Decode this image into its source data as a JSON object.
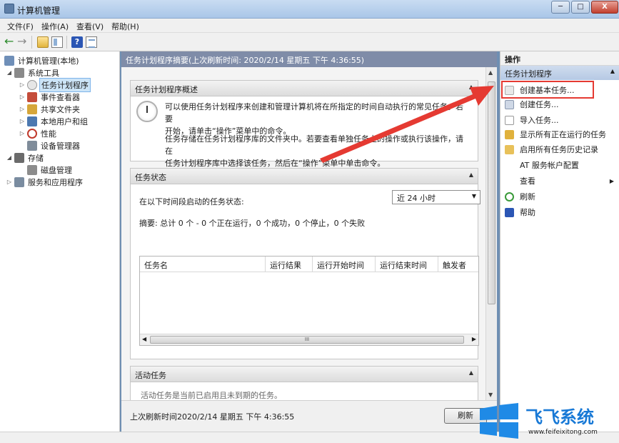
{
  "window": {
    "title": "计算机管理"
  },
  "window_buttons": {
    "minimize": "─",
    "maximize": "□",
    "close": "X"
  },
  "menu": [
    "文件(F)",
    "操作(A)",
    "查看(V)",
    "帮助(H)"
  ],
  "toolbar": {
    "back_icon": "←",
    "forward_icon": "→",
    "help_label": "?"
  },
  "tree": {
    "items": [
      {
        "label": "计算机管理(本地)",
        "icon": "computer-icon",
        "color": "#6f8fb8"
      },
      {
        "label": "系统工具",
        "icon": "tools-icon",
        "color": "#8a8a8a"
      },
      {
        "label": "任务计划程序",
        "icon": "clock-icon",
        "color": "#d9d9d9"
      },
      {
        "label": "事件查看器",
        "icon": "event-viewer-icon",
        "color": "#c44c3a"
      },
      {
        "label": "共享文件夹",
        "icon": "shared-folder-icon",
        "color": "#d6a63a"
      },
      {
        "label": "本地用户和组",
        "icon": "users-icon",
        "color": "#4c78b0"
      },
      {
        "label": "性能",
        "icon": "performance-icon",
        "color": "#c0392b"
      },
      {
        "label": "设备管理器",
        "icon": "device-manager-icon",
        "color": "#7f8c9a"
      },
      {
        "label": "存储",
        "icon": "storage-icon",
        "color": "#6b6b6b"
      },
      {
        "label": "磁盘管理",
        "icon": "disk-icon",
        "color": "#8c8c8c"
      },
      {
        "label": "服务和应用程序",
        "icon": "services-icon",
        "color": "#7a8ca0"
      }
    ]
  },
  "center": {
    "header": "任务计划程序摘要(上次刷新时间: 2020/2/14 星期五 下午 4:36:55)",
    "overview": {
      "title": "任务计划程序概述",
      "p1_line1": "可以使用任务计划程序来创建和管理计算机将在所指定的时间自动执行的常见任务。若要",
      "p1_line2": "开始，请单击“操作”菜单中的命令。",
      "p2_line1": "任务存储在任务计划程序库的文件夹中。若要查看单独任务上的操作或执行该操作，请在",
      "p2_line2": "任务计划程序库中选择该任务，然后在“操作”菜单中单击命令。"
    },
    "status": {
      "title": "任务状态",
      "period_label": "在以下时间段启动的任务状态:",
      "period_value": "近 24 小时",
      "summary": "摘要: 总计 0 个 - 0 个正在运行，0 个成功，0 个停止，0 个失败",
      "columns": [
        "任务名",
        "运行结果",
        "运行开始时间",
        "运行结束时间",
        "触发者"
      ],
      "hscroll_grip": "III"
    },
    "active": {
      "title": "活动任务",
      "partial_text": "活动任务是当前已启用且未到期的任务。"
    },
    "footer": {
      "last_refresh": "上次刷新时间2020/2/14 星期五 下午 4:36:55",
      "refresh_button": "刷新"
    }
  },
  "actions": {
    "header": "操作",
    "section": "任务计划程序",
    "items": [
      {
        "label": "创建基本任务...",
        "icon": "create-basic-task-icon",
        "color": "#e8e8e8"
      },
      {
        "label": "创建任务...",
        "icon": "create-task-icon",
        "color": "#cfd8e6"
      },
      {
        "label": "导入任务...",
        "icon": "import-task-icon",
        "color": "#ffffff"
      },
      {
        "label": "显示所有正在运行的任务",
        "icon": "running-tasks-icon",
        "color": "#e0b13c"
      },
      {
        "label": "启用所有任务历史记录",
        "icon": "history-icon",
        "color": "#e8c15a"
      },
      {
        "label": "AT 服务帐户配置",
        "icon": "",
        "color": ""
      },
      {
        "label": "查看",
        "icon": "",
        "color": ""
      },
      {
        "label": "刷新",
        "icon": "refresh-icon",
        "color": "#3a9a3a"
      },
      {
        "label": "帮助",
        "icon": "help-icon",
        "color": "#2b56b4"
      }
    ]
  },
  "watermark": {
    "title": "飞飞系统",
    "url": "www.feifeixitong.com"
  }
}
